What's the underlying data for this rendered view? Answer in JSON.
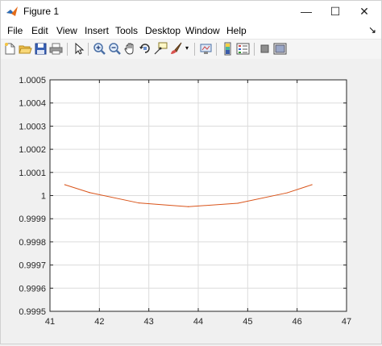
{
  "window": {
    "title": "Figure 1",
    "controls": {
      "minimize": "—",
      "maximize": "☐",
      "close": "✕"
    }
  },
  "menu": {
    "items": [
      "File",
      "Edit",
      "View",
      "Insert",
      "Tools",
      "Desktop",
      "Window",
      "Help"
    ],
    "overflow_arrow": "↘"
  },
  "toolbar": {
    "icons": [
      "new-figure-icon",
      "open-file-icon",
      "save-icon",
      "print-icon",
      "edit-plot-arrow-icon",
      "zoom-in-icon",
      "zoom-out-icon",
      "pan-hand-icon",
      "rotate-3d-icon",
      "data-cursor-icon",
      "brush-icon",
      "brush-dropdown-icon",
      "link-plot-icon",
      "colorbar-icon",
      "legend-icon",
      "hide-plot-tools-icon",
      "show-plot-tools-icon"
    ]
  },
  "chart_data": {
    "type": "line",
    "x": [
      41.3,
      41.8,
      42.8,
      43.8,
      44.8,
      45.8,
      46.3
    ],
    "series": [
      {
        "values": [
          1.000047,
          1.000013,
          0.999968,
          0.999952,
          0.999967,
          1.000012,
          1.000047
        ],
        "color": "#d95319"
      }
    ],
    "xlim": [
      41,
      47
    ],
    "ylim": [
      0.9995,
      1.0005
    ],
    "xticks": [
      "41",
      "42",
      "43",
      "44",
      "45",
      "46",
      "47"
    ],
    "yticks": [
      "0.9995",
      "0.9996",
      "0.9997",
      "0.9998",
      "0.9999",
      "1",
      "1.0001",
      "1.0002",
      "1.0003",
      "1.0004",
      "1.0005"
    ],
    "grid": true,
    "axes_background": "#ffffff",
    "figure_background": "#f0f0f0"
  }
}
